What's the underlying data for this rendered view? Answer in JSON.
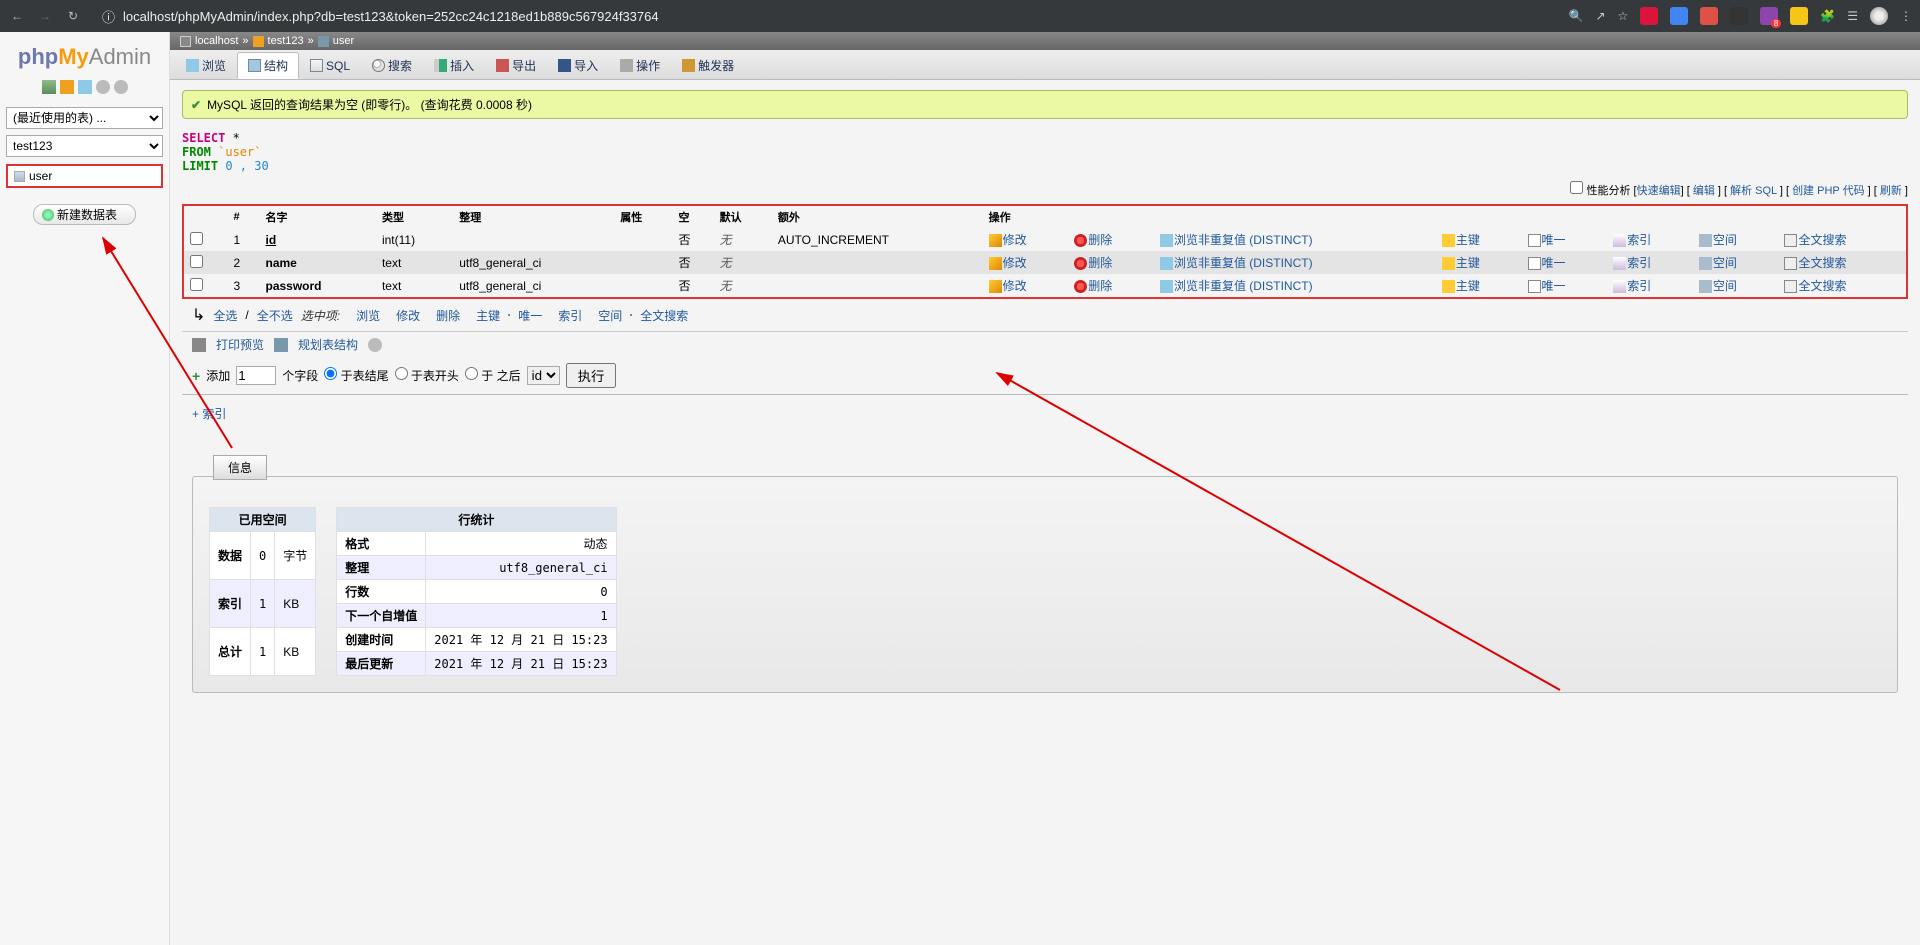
{
  "browser": {
    "url": "localhost/phpMyAdmin/index.php?db=test123&token=252cc24c1218ed1b889c567924f33764"
  },
  "logo": {
    "php": "php",
    "my": "My",
    "admin": "Admin"
  },
  "sidebar": {
    "recent_select": "(最近使用的表) ...",
    "db_select": "test123",
    "table_item": "user",
    "new_table": "新建数据表"
  },
  "crumb": {
    "server": "localhost",
    "db": "test123",
    "table": "user"
  },
  "tabs": {
    "browse": "浏览",
    "structure": "结构",
    "sql": "SQL",
    "search": "搜索",
    "insert": "插入",
    "export": "导出",
    "import": "导入",
    "operations": "操作",
    "triggers": "触发器"
  },
  "notice": "MySQL 返回的查询结果为空 (即零行)。 (查询花费 0.0008 秒)",
  "sql": {
    "select": "SELECT",
    "star": " *",
    "from": "FROM",
    "tbl": " `user`",
    "limit": "LIMIT",
    "nums": " 0 , 30"
  },
  "action_links": {
    "profile": "性能分析",
    "inline": "快速编辑",
    "edit": "编辑",
    "explain": "解析 SQL",
    "php": "创建 PHP 代码",
    "refresh": "刷新"
  },
  "cols_header": {
    "n": "#",
    "name": "名字",
    "type": "类型",
    "coll": "整理",
    "attr": "属性",
    "null": "空",
    "def": "默认",
    "extra": "额外",
    "ops": "操作"
  },
  "ops": {
    "edit": "修改",
    "drop": "删除",
    "browse": "浏览非重复值 (DISTINCT)",
    "primary": "主键",
    "unique": "唯一",
    "index": "索引",
    "spatial": "空间",
    "fulltext": "全文搜索"
  },
  "columns": [
    {
      "n": "1",
      "name": "id",
      "type": "int(11)",
      "coll": "",
      "null": "否",
      "def": "无",
      "extra": "AUTO_INCREMENT"
    },
    {
      "n": "2",
      "name": "name",
      "type": "text",
      "coll": "utf8_general_ci",
      "null": "否",
      "def": "无",
      "extra": ""
    },
    {
      "n": "3",
      "name": "password",
      "type": "text",
      "coll": "utf8_general_ci",
      "null": "否",
      "def": "无",
      "extra": ""
    }
  ],
  "bulk": {
    "all": "全选",
    "none": "全不选",
    "with": "选中项:",
    "browse": "浏览",
    "edit": "修改",
    "drop": "删除",
    "primary": "主键",
    "unique": "唯一",
    "index": "索引",
    "spatial": "空间",
    "fulltext": "全文搜索"
  },
  "tools": {
    "print": "打印预览",
    "analyze": "规划表结构"
  },
  "add": {
    "label": "添加",
    "count": "1",
    "fields": "个字段",
    "end": "于表结尾",
    "begin": "于表开头",
    "after": "于 之后",
    "col": "id",
    "go": "执行"
  },
  "idx_toggle": "+ 索引",
  "info": {
    "badge": "信息",
    "space_hdr": "已用空间",
    "space": [
      {
        "k": "数据",
        "v": "0",
        "u": "字节"
      },
      {
        "k": "索引",
        "v": "1",
        "u": "KB"
      },
      {
        "k": "总计",
        "v": "1",
        "u": "KB"
      }
    ],
    "stats_hdr": "行统计",
    "stats": [
      {
        "k": "格式",
        "v": "动态"
      },
      {
        "k": "整理",
        "v": "utf8_general_ci"
      },
      {
        "k": "行数",
        "v": "0"
      },
      {
        "k": "下一个自增值",
        "v": "1"
      },
      {
        "k": "创建时间",
        "v": "2021 年 12 月 21 日 15:23"
      },
      {
        "k": "最后更新",
        "v": "2021 年 12 月 21 日 15:23"
      }
    ]
  }
}
